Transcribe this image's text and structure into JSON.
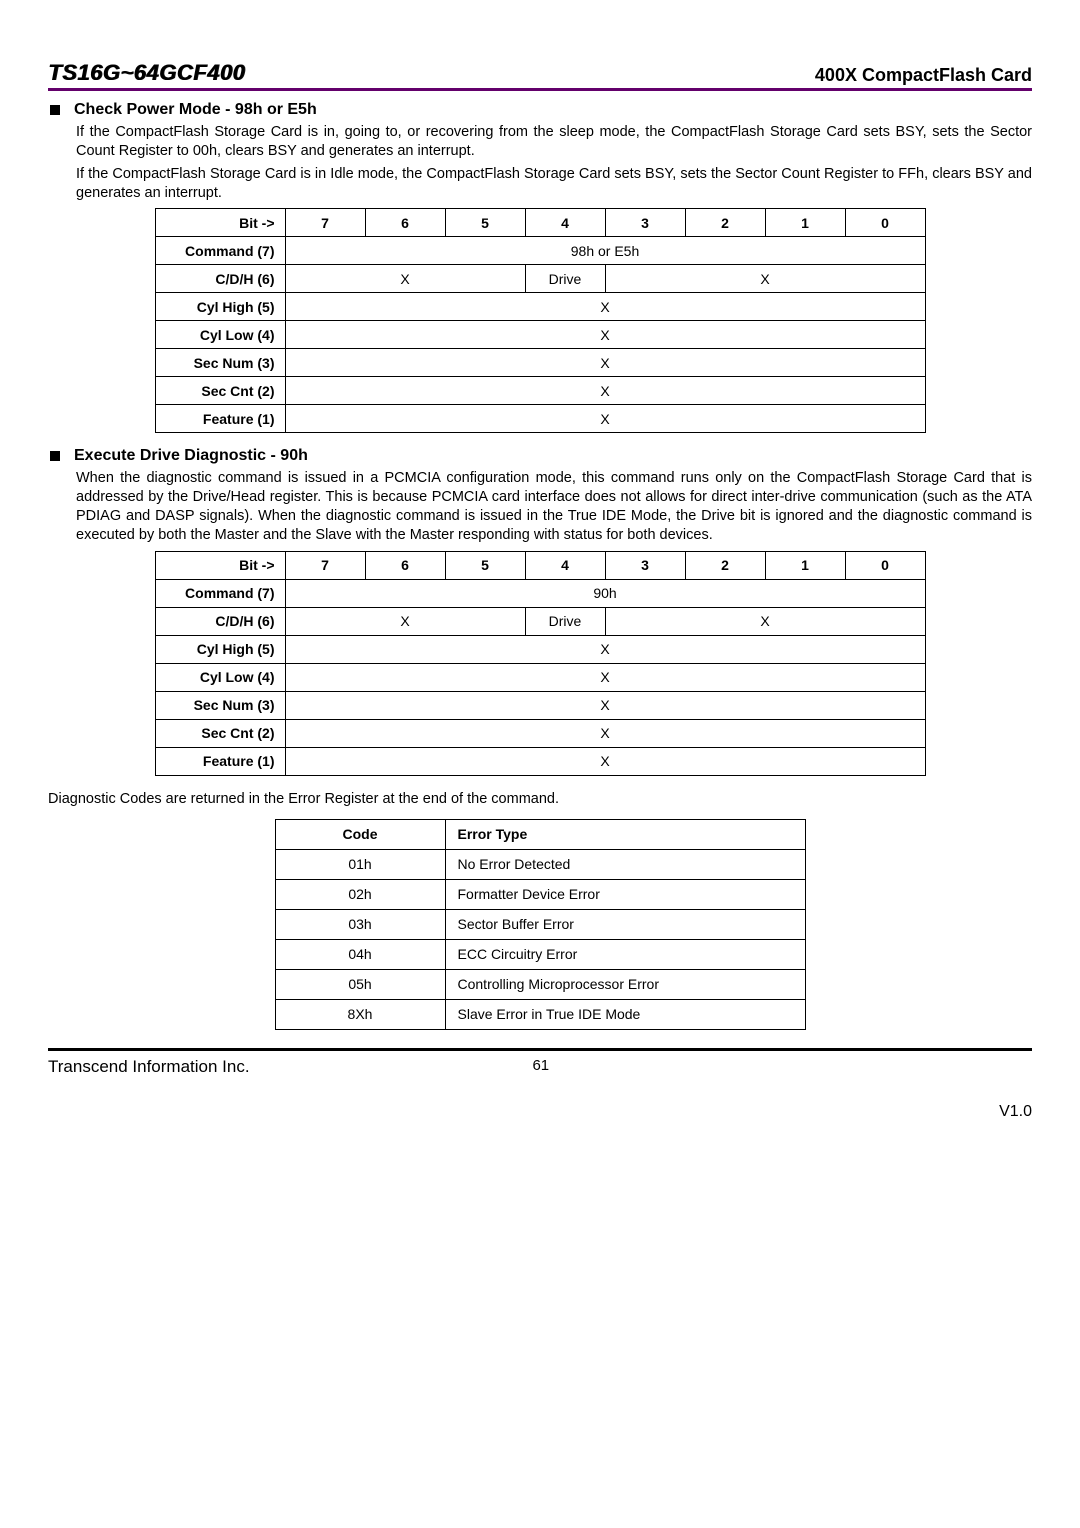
{
  "header": {
    "left": "TS16G~64GCF400",
    "right": "400X CompactFlash Card"
  },
  "section1": {
    "title": "Check Power Mode - 98h or E5h",
    "p1": "If the CompactFlash Storage Card is in, going to, or recovering from the sleep mode, the CompactFlash Storage Card sets BSY, sets the Sector Count Register to 00h, clears BSY and generates an interrupt.",
    "p2": "If the CompactFlash Storage Card is in Idle mode, the CompactFlash Storage Card sets BSY, sets the Sector Count Register to FFh, clears BSY and generates an interrupt."
  },
  "bits_header": {
    "label": "Bit ->",
    "b7": "7",
    "b6": "6",
    "b5": "5",
    "b4": "4",
    "b3": "3",
    "b2": "2",
    "b1": "1",
    "b0": "0"
  },
  "rowlabels": {
    "cmd": "Command (7)",
    "cdh": "C/D/H (6)",
    "cylh": "Cyl High (5)",
    "cyll": "Cyl Low (4)",
    "secn": "Sec Num (3)",
    "secc": "Sec Cnt (2)",
    "feat": "Feature (1)"
  },
  "table1": {
    "cmd_val": "98h or E5h",
    "cdh_left": "X",
    "cdh_drive": "Drive",
    "cdh_right": "X",
    "x": "X"
  },
  "section2": {
    "title": "Execute Drive Diagnostic - 90h",
    "p1": "When the diagnostic command is issued in a PCMCIA configuration mode, this command runs only on the CompactFlash Storage Card that is addressed by the Drive/Head register. This is because PCMCIA card interface does not allows for direct inter-drive communication (such as the ATA PDIAG and DASP signals). When the diagnostic command is issued in the True IDE Mode, the Drive bit is ignored and the diagnostic command is executed by both the Master and the Slave with the Master responding with status for both devices."
  },
  "table2": {
    "cmd_val": "90h",
    "cdh_left": "X",
    "cdh_drive": "Drive",
    "cdh_right": "X",
    "x": "X"
  },
  "diag_intro": "Diagnostic Codes are returned in the Error Register at the end of the command.",
  "diag_table": {
    "h1": "Code",
    "h2": "Error Type",
    "rows": [
      {
        "code": "01h",
        "err": "No Error Detected"
      },
      {
        "code": "02h",
        "err": "Formatter Device Error"
      },
      {
        "code": "03h",
        "err": "Sector Buffer Error"
      },
      {
        "code": "04h",
        "err": "ECC Circuitry Error"
      },
      {
        "code": "05h",
        "err": "Controlling Microprocessor Error"
      },
      {
        "code": "8Xh",
        "err": "Slave Error in True IDE Mode"
      }
    ]
  },
  "footer": {
    "left": "Transcend Information Inc.",
    "page": "61",
    "version": "V1.0"
  },
  "chart_data": [
    {
      "type": "table",
      "title": "Check Power Mode - 98h or E5h register map",
      "columns": [
        "Bit 7",
        "Bit 6",
        "Bit 5",
        "Bit 4",
        "Bit 3",
        "Bit 2",
        "Bit 1",
        "Bit 0"
      ],
      "rows": [
        {
          "register": "Command (7)",
          "cells": [
            "98h or E5h (bits 7-0)"
          ]
        },
        {
          "register": "C/D/H (6)",
          "cells": [
            "X (bits 7-5)",
            "Drive (bit 4)",
            "X (bits 3-0)"
          ]
        },
        {
          "register": "Cyl High (5)",
          "cells": [
            "X (bits 7-0)"
          ]
        },
        {
          "register": "Cyl Low (4)",
          "cells": [
            "X (bits 7-0)"
          ]
        },
        {
          "register": "Sec Num (3)",
          "cells": [
            "X (bits 7-0)"
          ]
        },
        {
          "register": "Sec Cnt (2)",
          "cells": [
            "X (bits 7-0)"
          ]
        },
        {
          "register": "Feature (1)",
          "cells": [
            "X (bits 7-0)"
          ]
        }
      ]
    },
    {
      "type": "table",
      "title": "Execute Drive Diagnostic - 90h register map",
      "columns": [
        "Bit 7",
        "Bit 6",
        "Bit 5",
        "Bit 4",
        "Bit 3",
        "Bit 2",
        "Bit 1",
        "Bit 0"
      ],
      "rows": [
        {
          "register": "Command (7)",
          "cells": [
            "90h (bits 7-0)"
          ]
        },
        {
          "register": "C/D/H (6)",
          "cells": [
            "X (bits 7-5)",
            "Drive (bit 4)",
            "X (bits 3-0)"
          ]
        },
        {
          "register": "Cyl High (5)",
          "cells": [
            "X (bits 7-0)"
          ]
        },
        {
          "register": "Cyl Low (4)",
          "cells": [
            "X (bits 7-0)"
          ]
        },
        {
          "register": "Sec Num (3)",
          "cells": [
            "X (bits 7-0)"
          ]
        },
        {
          "register": "Sec Cnt (2)",
          "cells": [
            "X (bits 7-0)"
          ]
        },
        {
          "register": "Feature (1)",
          "cells": [
            "X (bits 7-0)"
          ]
        }
      ]
    },
    {
      "type": "table",
      "title": "Diagnostic Codes",
      "columns": [
        "Code",
        "Error Type"
      ],
      "rows": [
        [
          "01h",
          "No Error Detected"
        ],
        [
          "02h",
          "Formatter Device Error"
        ],
        [
          "03h",
          "Sector Buffer Error"
        ],
        [
          "04h",
          "ECC Circuitry Error"
        ],
        [
          "05h",
          "Controlling Microprocessor Error"
        ],
        [
          "8Xh",
          "Slave Error in True IDE Mode"
        ]
      ]
    }
  ]
}
